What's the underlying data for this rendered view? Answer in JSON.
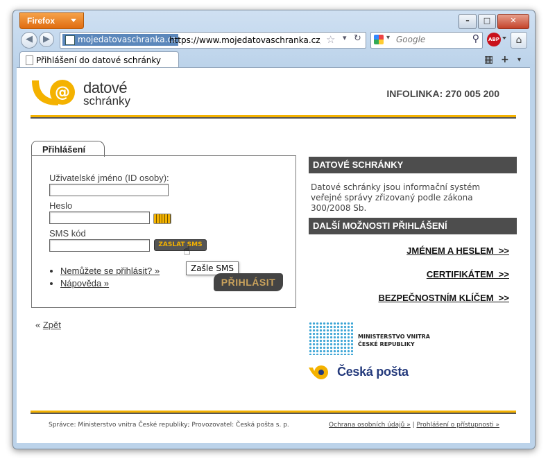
{
  "browser": {
    "app_button": "Firefox",
    "site_identity": "mojedatovaschranka.cz",
    "url": "https://www.mojedatovaschranka.cz/as/li",
    "search_placeholder": "Google",
    "abp_label": "ABP",
    "tab_title": "Přihlášení do datové schránky"
  },
  "header": {
    "logo_line1": "datové",
    "logo_line2": "schránky",
    "infoline": "INFOLINKA: 270 005 200"
  },
  "login": {
    "tab_label": "Přihlášení",
    "username_label": "Uživatelské jméno (ID osoby):",
    "password_label": "Heslo",
    "sms_label": "SMS kód",
    "send_sms_button": "ZASLAT SMS",
    "tooltip": "Zašle SMS",
    "links": [
      "Nemůžete se přihlásit? »",
      "Nápověda »"
    ],
    "submit": "PŘIHLÁSIT",
    "back_prefix": "« ",
    "back_link": "Zpět"
  },
  "sidebar": {
    "box1_title": "DATOVÉ SCHRÁNKY",
    "box1_text": "Datové schránky jsou informační systém veřejné správy zřizovaný podle zákona 300/2008 Sb.",
    "box2_title": "DALŠÍ MOŽNOSTI PŘIHLÁŠENÍ",
    "options": [
      "JMÉNEM A HESLEM  >>",
      "CERTIFIKÁTEM  >>",
      "BEZPEČNOSTNÍM KLÍČEM  >>"
    ],
    "mv_line1": "MINISTERSTVO VNITRA",
    "mv_line2": "ČESKÉ REPUBLIKY",
    "cp_name": "Česká pošta"
  },
  "footer": {
    "left": "Správce: Ministerstvo vnitra České republiky; Provozovatel: Česká pošta s. p.",
    "link1": "Ochrana osobních údajů »",
    "separator": " | ",
    "link2": "Prohlášení o přístupnosti »"
  },
  "colors": {
    "brand_gold": "#f4b200",
    "dark_gray": "#4d4d4d",
    "titlebar": "#bcd3ea"
  }
}
